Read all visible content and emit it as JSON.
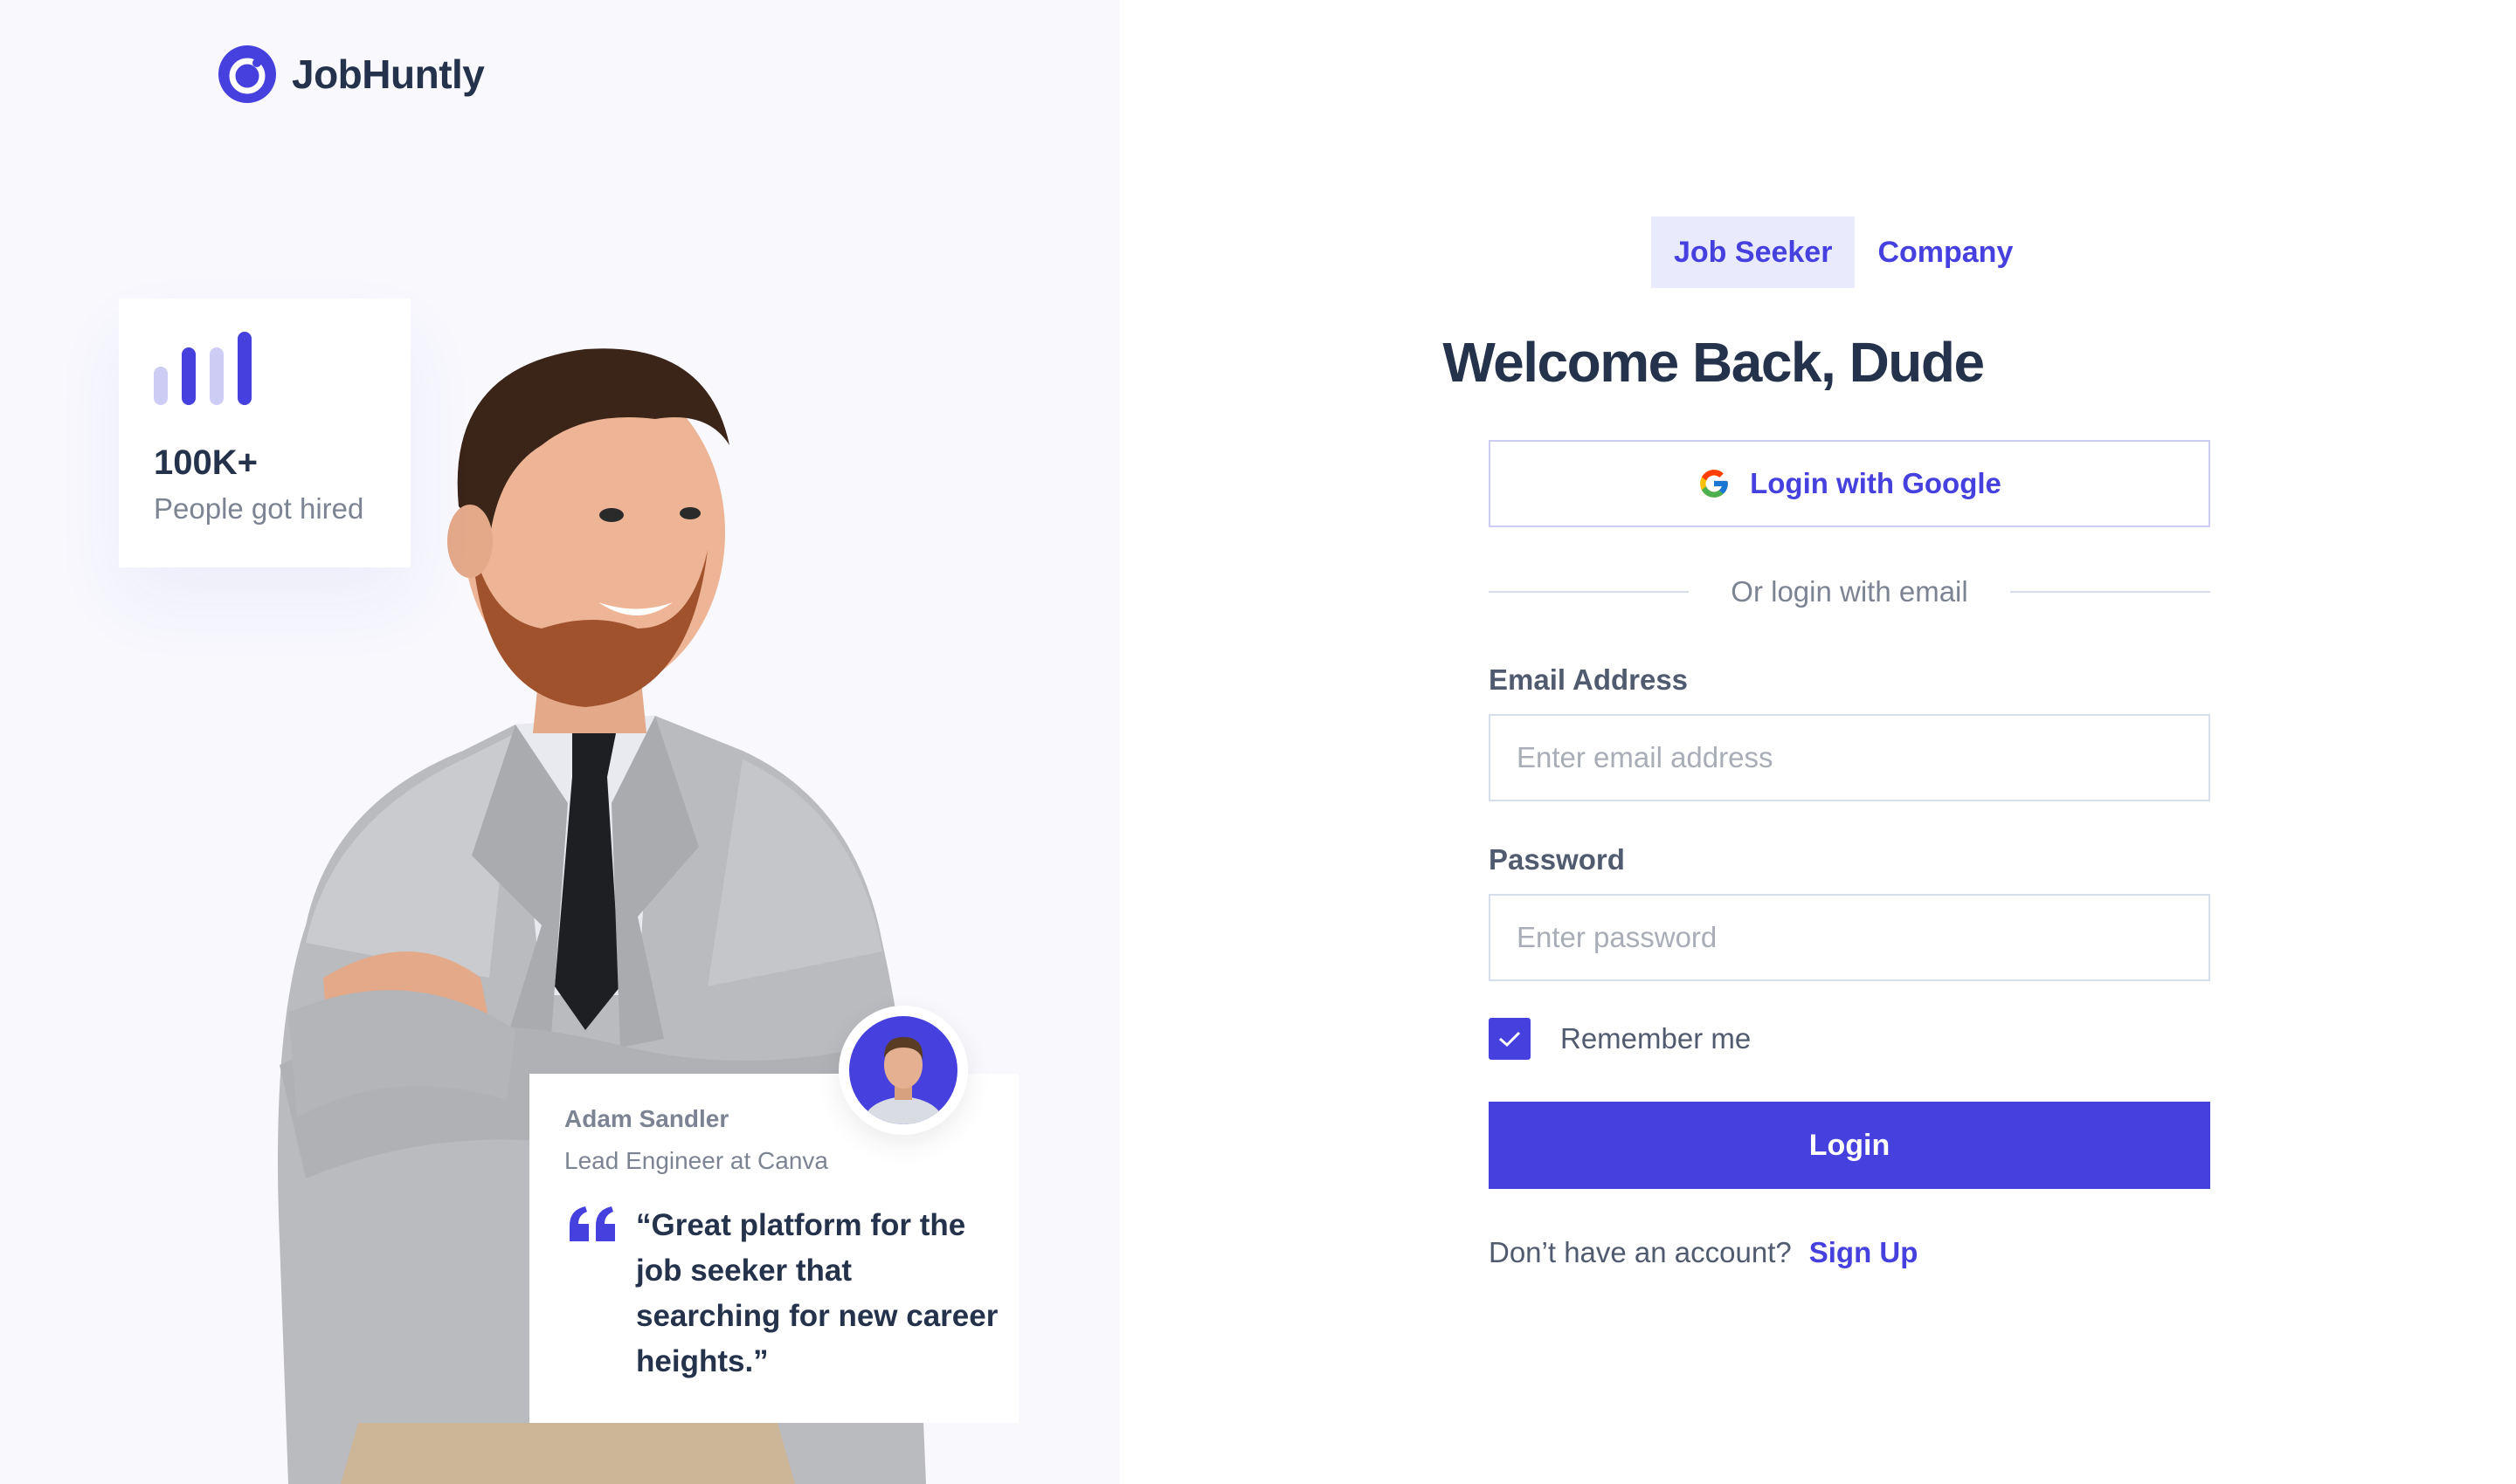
{
  "brand": {
    "name": "JobHuntly",
    "color": "#4640DE"
  },
  "stats": {
    "value": "100K+",
    "label": "People got hired"
  },
  "testimonial": {
    "name": "Adam Sandler",
    "role": "Lead Engineer at Canva",
    "quote": "“Great platform for the job seeker that searching for new career heights.”"
  },
  "tabs": [
    {
      "label": "Job Seeker",
      "active": true
    },
    {
      "label": "Company",
      "active": false
    }
  ],
  "heading": "Welcome Back, Dude",
  "google_button": {
    "label": "Login with Google"
  },
  "divider_text": "Or login with email",
  "email": {
    "label": "Email Address",
    "placeholder": "Enter email address",
    "value": ""
  },
  "password": {
    "label": "Password",
    "placeholder": "Enter password",
    "value": ""
  },
  "remember": {
    "label": "Remember me",
    "checked": true
  },
  "login_button": {
    "label": "Login"
  },
  "signup": {
    "prompt": "Don’t have an account?",
    "link": "Sign Up"
  },
  "colors": {
    "primary": "#4640DE",
    "left_panel_bg": "#F8F8FD",
    "text_dark": "#25324B",
    "text_muted": "#7C8493"
  }
}
